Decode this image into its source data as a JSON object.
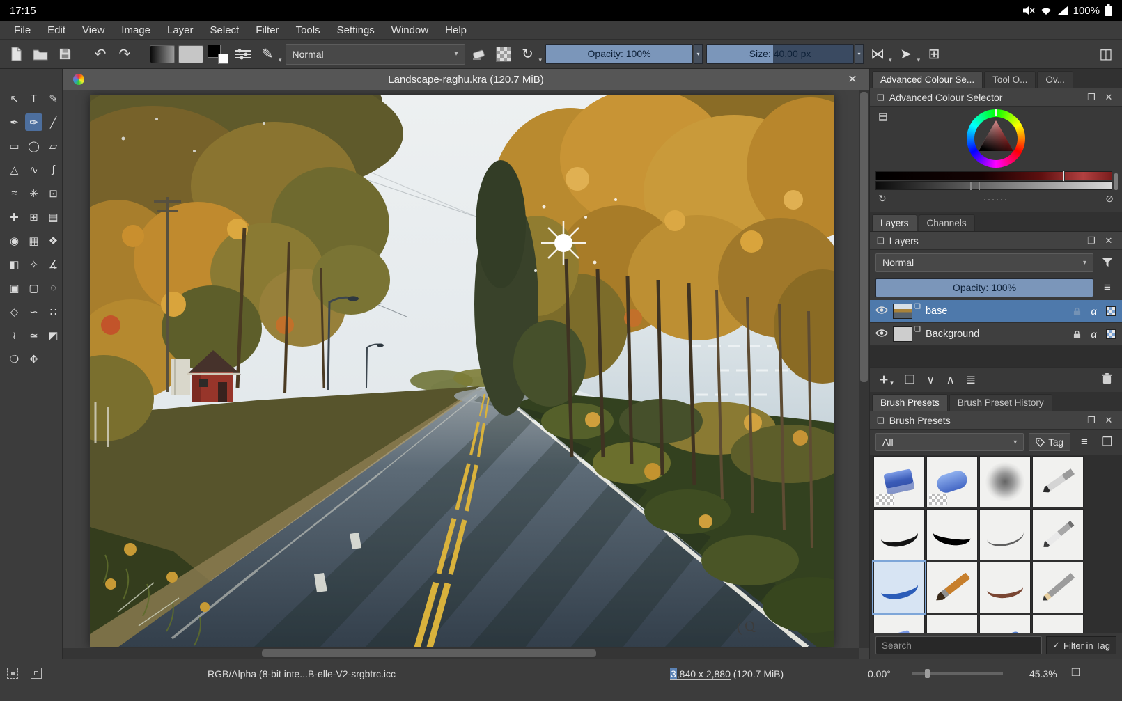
{
  "android_status": {
    "time": "17:15",
    "battery": "100%"
  },
  "menu": {
    "items": [
      "File",
      "Edit",
      "View",
      "Image",
      "Layer",
      "Select",
      "Filter",
      "Tools",
      "Settings",
      "Window",
      "Help"
    ]
  },
  "icons": {
    "undo": "↶",
    "redo": "↷",
    "caret": "▾",
    "brush_editor": "✎",
    "reload": "↻",
    "mirror_h": "⋈",
    "mirror_v": "➤",
    "trim": "⊞",
    "workspace": "◫",
    "docker": "❏",
    "float": "❐",
    "close": "✕",
    "menu": "≡",
    "refresh": "↻",
    "gamut_mask_off": "⊘",
    "settings_grid": "▤",
    "dots_handle": "······",
    "add": "+",
    "duplicate": "❏",
    "move_down": "∨",
    "move_up": "∧",
    "properties": "≣",
    "alpha": "α",
    "check": "✓",
    "canvas_only": "❒",
    "grid_view": "❒"
  },
  "toolbar": {
    "blend_mode": "Normal",
    "opacity": "Opacity: 100%",
    "size": "Size: 40.00 px"
  },
  "toolbox": {
    "tools": [
      {
        "name": "select-shapes-tool",
        "glyph": "↖"
      },
      {
        "name": "text-tool",
        "glyph": "T"
      },
      {
        "name": "edit-shapes-tool",
        "glyph": "✎"
      },
      {
        "name": "calligraphy-tool",
        "glyph": "✒"
      },
      {
        "name": "freehand-brush-tool",
        "glyph": "✑",
        "selected": true
      },
      {
        "name": "line-tool",
        "glyph": "╱"
      },
      {
        "name": "rectangle-tool",
        "glyph": "▭"
      },
      {
        "name": "ellipse-tool",
        "glyph": "◯"
      },
      {
        "name": "polygon-tool",
        "glyph": "▱"
      },
      {
        "name": "polyline-tool",
        "glyph": "△"
      },
      {
        "name": "bezier-curve-tool",
        "glyph": "∿"
      },
      {
        "name": "freehand-path-tool",
        "glyph": "∫"
      },
      {
        "name": "dynamic-brush-tool",
        "glyph": "≈"
      },
      {
        "name": "multibrush-tool",
        "glyph": "✳"
      },
      {
        "name": "transform-tool",
        "glyph": "⊡"
      },
      {
        "name": "move-tool",
        "glyph": "✚"
      },
      {
        "name": "crop-tool",
        "glyph": "⊞"
      },
      {
        "name": "gradient-tool",
        "glyph": "▤"
      },
      {
        "name": "color-sampler-tool",
        "glyph": "◉"
      },
      {
        "name": "pattern-edit-tool",
        "glyph": "▦"
      },
      {
        "name": "smart-patch-tool",
        "glyph": "❖"
      },
      {
        "name": "fill-tool",
        "glyph": "◧"
      },
      {
        "name": "assistants-tool",
        "glyph": "✧"
      },
      {
        "name": "measure-tool",
        "glyph": "∡"
      },
      {
        "name": "reference-images-tool",
        "glyph": "▣"
      },
      {
        "name": "rect-select-tool",
        "glyph": "▢"
      },
      {
        "name": "ellipse-select-tool",
        "glyph": "◌"
      },
      {
        "name": "polygon-select-tool",
        "glyph": "◇"
      },
      {
        "name": "freehand-select-tool",
        "glyph": "∽"
      },
      {
        "name": "similar-select-tool",
        "glyph": "∷"
      },
      {
        "name": "bezier-select-tool",
        "glyph": "≀"
      },
      {
        "name": "magnetic-select-tool",
        "glyph": "≃"
      },
      {
        "name": "contiguous-select-tool",
        "glyph": "◩"
      },
      {
        "name": "zoom-tool",
        "glyph": "❍"
      },
      {
        "name": "pan-tool",
        "glyph": "✥"
      }
    ]
  },
  "canvas": {
    "title": "Landscape-raghu.kra (120.7 MiB)"
  },
  "right_panel": {
    "docker_tabs": [
      {
        "label": "Advanced Colour Se...",
        "active": true
      },
      {
        "label": "Tool O...",
        "active": false
      },
      {
        "label": "Ov...",
        "active": false
      }
    ],
    "color_selector": {
      "title": "Advanced Colour Selector"
    },
    "layer_tabs": [
      {
        "label": "Layers",
        "active": true
      },
      {
        "label": "Channels",
        "active": false
      }
    ],
    "layers": {
      "title": "Layers",
      "blend_mode": "Normal",
      "opacity": "Opacity:  100%",
      "rows": [
        {
          "name": "base",
          "selected": true,
          "locked": false
        },
        {
          "name": "Background",
          "selected": false,
          "locked": true
        }
      ]
    },
    "brush_tabs": [
      {
        "label": "Brush Presets",
        "active": true
      },
      {
        "label": "Brush Preset History",
        "active": false
      }
    ],
    "brush_presets": {
      "title": "Brush Presets",
      "tag_filter": "All",
      "tag_button": "Tag",
      "search_placeholder": "Search",
      "filter_in_tag": "Filter in Tag",
      "items": [
        {
          "name": "eraser-hard",
          "variant": "eraser-block"
        },
        {
          "name": "eraser-soft",
          "variant": "eraser-soft"
        },
        {
          "name": "airbrush-soft",
          "variant": "airbrush"
        },
        {
          "name": "ink-pen",
          "variant": "ink-pen"
        },
        {
          "name": "pen-black",
          "variant": "pen-black"
        },
        {
          "name": "pen-bold",
          "variant": "pen-bold"
        },
        {
          "name": "pen-fine",
          "variant": "pen-fine"
        },
        {
          "name": "metal-pen",
          "variant": "pen-metal"
        },
        {
          "name": "marker-blue",
          "variant": "marker-blue",
          "selected": true
        },
        {
          "name": "paintbrush",
          "variant": "paintbrush"
        },
        {
          "name": "sketch-brush",
          "variant": "brush-sketch"
        },
        {
          "name": "pencil",
          "variant": "pencil"
        },
        {
          "name": "eraser-thin",
          "variant": "eraser-thin"
        },
        {
          "name": "pen-blue",
          "variant": "pen-blue"
        },
        {
          "name": "marker-blue-2",
          "variant": "marker-blue2"
        },
        {
          "name": "pencil-soft",
          "variant": "pencil-soft"
        }
      ]
    }
  },
  "statusbar": {
    "color_profile": "RGB/Alpha (8-bit inte...B-elle-V2-srgbtrc.icc",
    "dim_selected": "3",
    "dim_link": ",840 x 2,880",
    "dim_size": " (120.7 MiB)",
    "angle": "0.00°",
    "zoom": "45.3%"
  }
}
